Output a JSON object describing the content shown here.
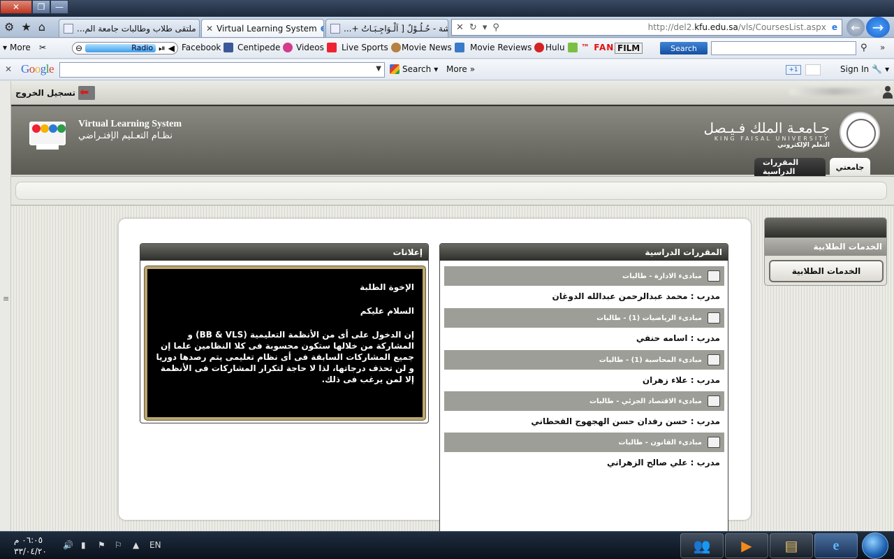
{
  "browser": {
    "tabs": [
      {
        "title": "ملتقى طلاب وطالبات جامعة الم..."
      },
      {
        "title": "Virtual Learning System"
      },
      {
        "title": "مناقشة - حُـلُـوْلٌ [ اَلْـوَاجِـبَـاتُ +..."
      }
    ],
    "url_prefix": "http://del2.",
    "url_host": "kfu.edu.sa",
    "url_path": "/vls/CoursesList.aspx"
  },
  "toolbar": {
    "more_label": "More",
    "radio_label": "Radio",
    "links": [
      "Facebook",
      "Centipede",
      "Videos",
      "Live Sports",
      "Movie News",
      "Movie Reviews",
      "Hulu"
    ],
    "fanatic_label": "FANATIC",
    "fanatic_sup": "™",
    "search_button": "Search"
  },
  "google_bar": {
    "logo": "Google",
    "search_label": "Search",
    "more_label": "More",
    "plusone": "+1",
    "signin": "Sign In"
  },
  "site": {
    "logout_label": "تسجيل الخروج",
    "vls_en": "Virtual Learning System",
    "vls_ar": "نظـام التعـليم الإفتـراضي",
    "kfu_ar": "جـامعـة الملك فـيـصل",
    "kfu_en": "KING FAISAL UNIVERSITY",
    "kfu_sub": "التعلم الإلكتروني",
    "tabs": {
      "my": "جامعتي",
      "courses": "المقررات الدراسية"
    }
  },
  "announcements": {
    "title": "إعلانات",
    "greeting": "الإخوة الطلبة",
    "salam": "السلام عليكم",
    "body": "إن الدخول على أى من الأنظمة التعليمية (BB & VLS) و المشاركة من خلالها ستكون محسوبة فى كلا النظامين علما إن جميع المشاركات السابقة فى أى نظام تعليمى يتم رصدها دوريا و لن تحذف درجاتها، لذا لا حاجة لتكرار المشاركات فى الأنظمة إلا لمن يرغب فى ذلك."
  },
  "courses": {
    "title": "المقررات الدراسية",
    "items": [
      {
        "name": "مبادىء الادارة - طالبات",
        "instructor": "مدرب : محمد عبدالرحمن عبدالله الدوغان"
      },
      {
        "name": "مبادىء الرياضيات (1) - طالبات",
        "instructor": "مدرب : اسامه حنفي"
      },
      {
        "name": "مبادىء المحاسبة (1) - طالبات",
        "instructor": "مدرب : علاء زهران"
      },
      {
        "name": "مبادىء الاقتصاد الجزئي - طالبات",
        "instructor": "مدرب : حسن رفدان حسن الهجهوج القحطاني"
      },
      {
        "name": "مبادىء القانون - طالبات",
        "instructor": "مدرب : علي صالح الزهراني"
      }
    ]
  },
  "side_panel": {
    "title": "الخدمات الطلابية",
    "button": "الخدمات الطلابية"
  },
  "taskbar": {
    "time": "٠٦:٠٥ م",
    "date": "٣٣/٠٤/٢٠",
    "lang": "EN"
  }
}
